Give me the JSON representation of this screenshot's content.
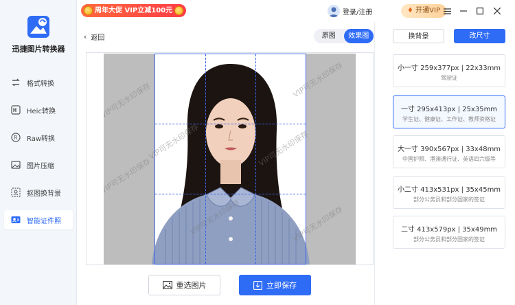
{
  "app": {
    "name": "迅捷图片转换器"
  },
  "sidebar": {
    "items": [
      {
        "label": "格式转换",
        "icon": "format-convert-icon"
      },
      {
        "label": "Heic转换",
        "icon": "heic-icon"
      },
      {
        "label": "Raw转换",
        "icon": "raw-icon"
      },
      {
        "label": "图片压缩",
        "icon": "image-compress-icon"
      },
      {
        "label": "抠图换背景",
        "icon": "cutout-icon"
      },
      {
        "label": "智能证件照",
        "icon": "id-photo-icon",
        "active": true
      }
    ]
  },
  "titlebar": {
    "promo": "周年大促 VIP立减100元",
    "login": "登录/注册",
    "vip": "开通VIP"
  },
  "main": {
    "back": "返回",
    "toggle": {
      "original": "原图",
      "effect": "效果图"
    },
    "watermark": "VIP可无水印保存",
    "reselect": "重选图片",
    "save": "立即保存"
  },
  "right": {
    "change_bg": "换背景",
    "change_size": "改尺寸",
    "options": [
      {
        "title": "小一寸 259x377px | 22x33mm",
        "desc": "驾驶证"
      },
      {
        "title": "一寸 295x413px | 25x35mm",
        "desc": "学生证、健康证、工作证、教师资格证",
        "selected": true
      },
      {
        "title": "大一寸 390x567px | 33x48mm",
        "desc": "中国护照、港澳通行证、英语四六级等"
      },
      {
        "title": "小二寸 413x531px | 35x45mm",
        "desc": "部分公务员和部分国家的签证"
      },
      {
        "title": "二寸 413x579px | 35x49mm",
        "desc": "部分公务员和部分国家的签证"
      }
    ]
  },
  "colors": {
    "accent": "#2f6cf6",
    "promo": "#ff3b46",
    "vip_gold": "#ffd29a"
  }
}
